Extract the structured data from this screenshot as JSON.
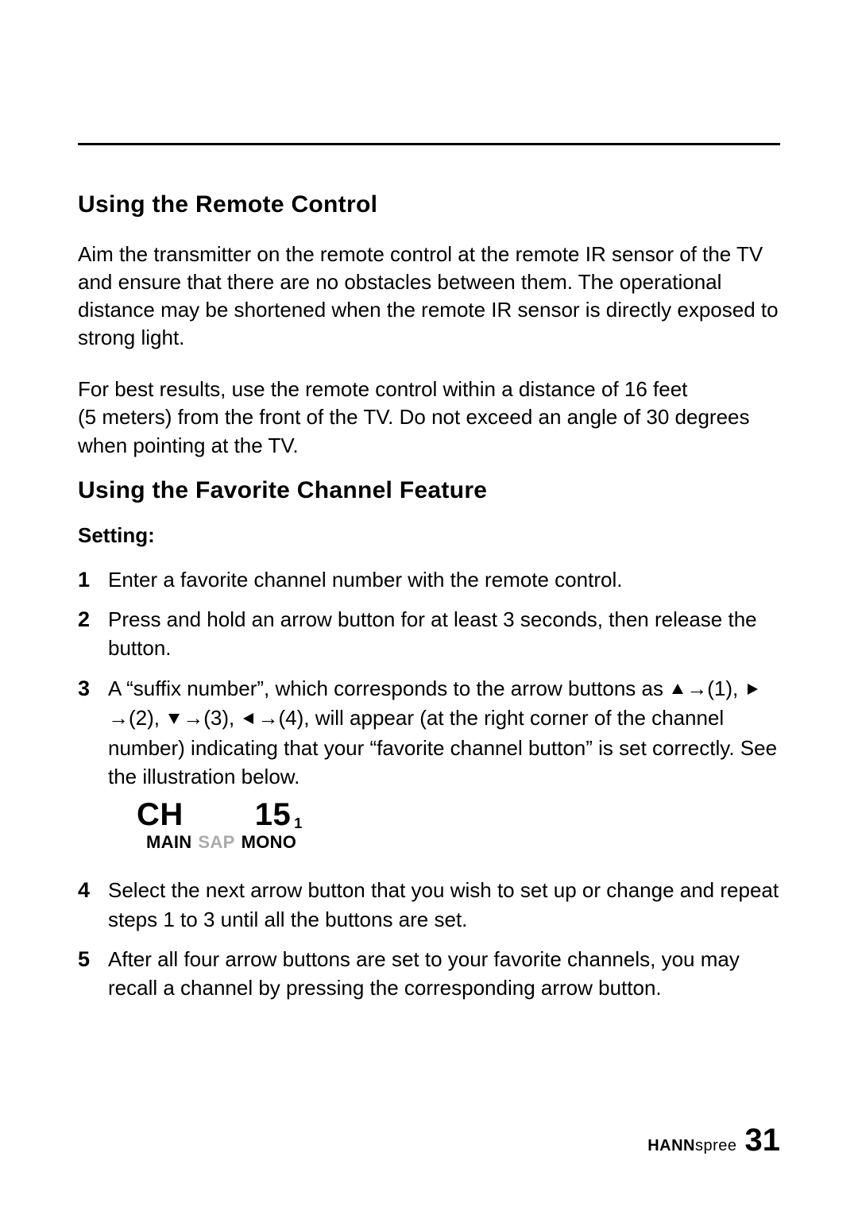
{
  "sections": {
    "remote": {
      "heading": "Using the Remote Control",
      "para1": "Aim the transmitter on the remote control at the remote IR sensor of the TV and ensure that there are no obstacles between them. The operational distance may be shortened when the remote IR sensor is directly exposed to strong light.",
      "para2": "For best results, use the remote control within a distance of 16 feet (5 meters) from the front of the TV. Do not exceed an angle of 30 degrees when pointing at the TV."
    },
    "favorite": {
      "heading": "Using the Favorite Channel Feature",
      "sub": "Setting:",
      "step1": "Enter a favorite channel number with the remote control.",
      "step2": "Press and hold an arrow button for at least 3 seconds, then release the button.",
      "step3_a": "A “suffix number”, which corresponds to the arrow buttons as ",
      "step3_map1": "(1), ",
      "step3_map2": "(2), ",
      "step3_map3": "(3), ",
      "step3_map4": "(4)",
      "step3_b": ", will appear (at the right corner of the channel number) indicating that your “favorite channel button” is set correctly. See the illustration below.",
      "step4": "Select the next arrow button that you wish to set up or change and repeat steps 1 to 3 until all the buttons are set.",
      "step5": "After all four arrow buttons are set to your favorite channels, you may recall a channel by pressing the corresponding arrow button."
    }
  },
  "illustration": {
    "ch_label": "CH",
    "ch_number": "15",
    "suffix": "1",
    "main": "MAIN",
    "sap": "SAP",
    "mono": "MONO"
  },
  "footer": {
    "brand_bold": "HANN",
    "brand_light": "spree",
    "page": "31"
  },
  "symbols": {
    "right_arrow": "→"
  }
}
